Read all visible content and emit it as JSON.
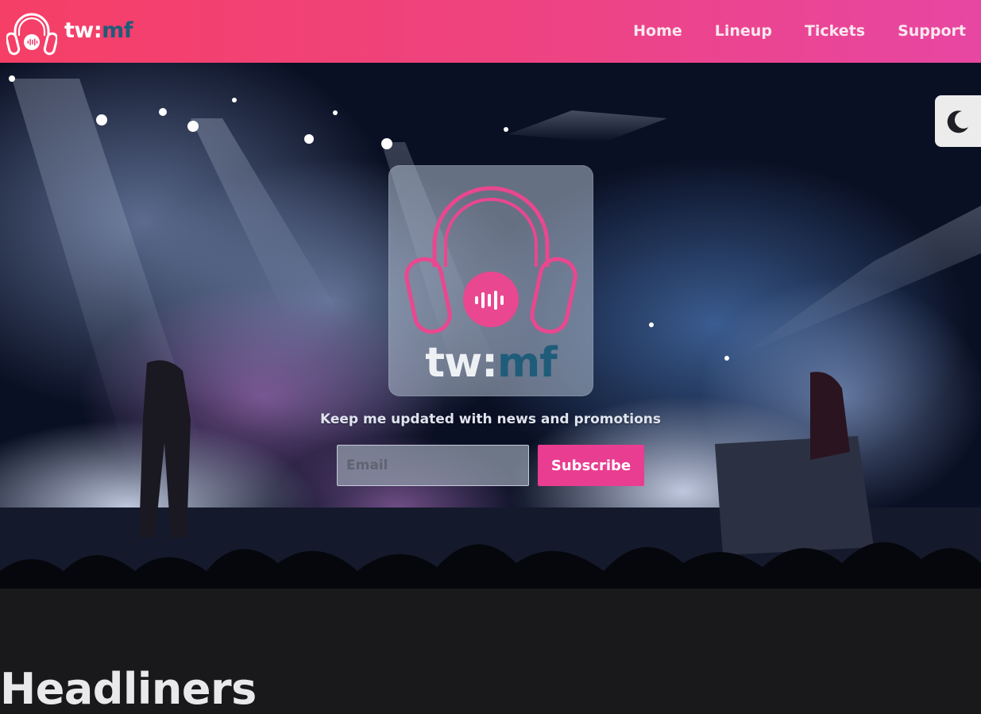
{
  "brand": {
    "name_part1": "tw:",
    "name_part2": "mf"
  },
  "nav": {
    "items": [
      "Home",
      "Lineup",
      "Tickets",
      "Support"
    ]
  },
  "hero": {
    "logo_word_part1": "tw:",
    "logo_word_part2": "mf",
    "promo_text": "Keep me updated with news and promotions",
    "email_placeholder": "Email",
    "email_value": "",
    "subscribe_label": "Subscribe",
    "theme_toggle_icon": "moon-icon"
  },
  "section": {
    "title": "Headliners"
  },
  "colors": {
    "header_gradient_start": "#f53f66",
    "header_gradient_end": "#e746a2",
    "accent_pink": "#e93d91",
    "brand_teal": "#1f5c7a",
    "page_background": "#19181b"
  }
}
